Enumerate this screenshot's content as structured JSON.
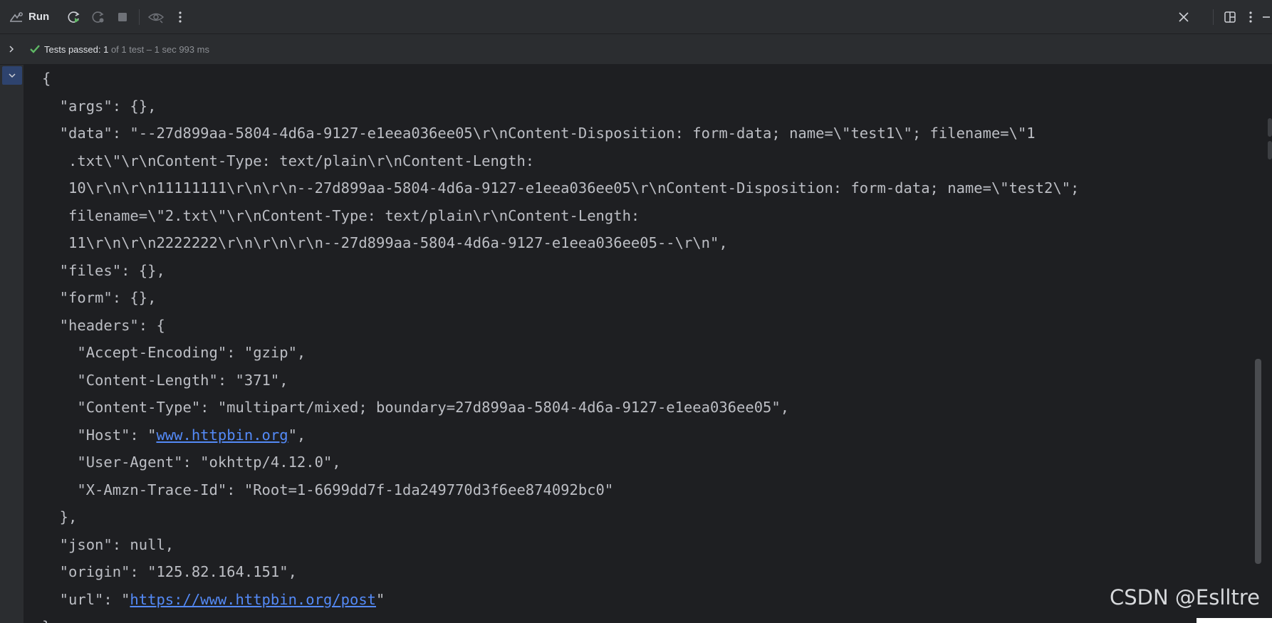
{
  "toolbar": {
    "run_label": "Run",
    "icons": [
      "run-tool-window-icon",
      "rerun-icon",
      "rerun-failed-icon",
      "stop-icon",
      "preview-icon",
      "more-vertical-icon",
      "close-icon",
      "layout-icon",
      "more-vertical-icon",
      "minimize-icon"
    ]
  },
  "status": {
    "passed_label": "Tests passed: 1",
    "detail": " of 1 test – 1 sec 993 ms"
  },
  "console": {
    "lines": [
      {
        "text": "{"
      },
      {
        "text": "  \"args\": {},"
      },
      {
        "text": "  \"data\": \"--27d899aa-5804-4d6a-9127-e1eea036ee05\\r\\nContent-Disposition: form-data; name=\\\"test1\\\"; filename=\\\"1"
      },
      {
        "text": "   .txt\\\"\\r\\nContent-Type: text/plain\\r\\nContent-Length:"
      },
      {
        "text": "   10\\r\\n\\r\\n11111111\\r\\n\\r\\n--27d899aa-5804-4d6a-9127-e1eea036ee05\\r\\nContent-Disposition: form-data; name=\\\"test2\\\";"
      },
      {
        "text": "   filename=\\\"2.txt\\\"\\r\\nContent-Type: text/plain\\r\\nContent-Length:"
      },
      {
        "text": "   11\\r\\n\\r\\n2222222\\r\\n\\r\\n\\r\\n--27d899aa-5804-4d6a-9127-e1eea036ee05--\\r\\n\","
      },
      {
        "text": "  \"files\": {},"
      },
      {
        "text": "  \"form\": {},"
      },
      {
        "text": "  \"headers\": {"
      },
      {
        "text": "    \"Accept-Encoding\": \"gzip\","
      },
      {
        "text": "    \"Content-Length\": \"371\","
      },
      {
        "text": "    \"Content-Type\": \"multipart/mixed; boundary=27d899aa-5804-4d6a-9127-e1eea036ee05\","
      },
      {
        "pre": "    \"Host\": \"",
        "link": "www.httpbin.org",
        "post": "\","
      },
      {
        "text": "    \"User-Agent\": \"okhttp/4.12.0\","
      },
      {
        "text": "    \"X-Amzn-Trace-Id\": \"Root=1-6699dd7f-1da249770d3f6ee874092bc0\""
      },
      {
        "text": "  },"
      },
      {
        "text": "  \"json\": null,"
      },
      {
        "text": "  \"origin\": \"125.82.164.151\","
      },
      {
        "pre": "  \"url\": \"",
        "link": "https://www.httpbin.org/post",
        "post": "\""
      },
      {
        "text": "}"
      }
    ]
  },
  "watermark": "CSDN @Eslltre"
}
